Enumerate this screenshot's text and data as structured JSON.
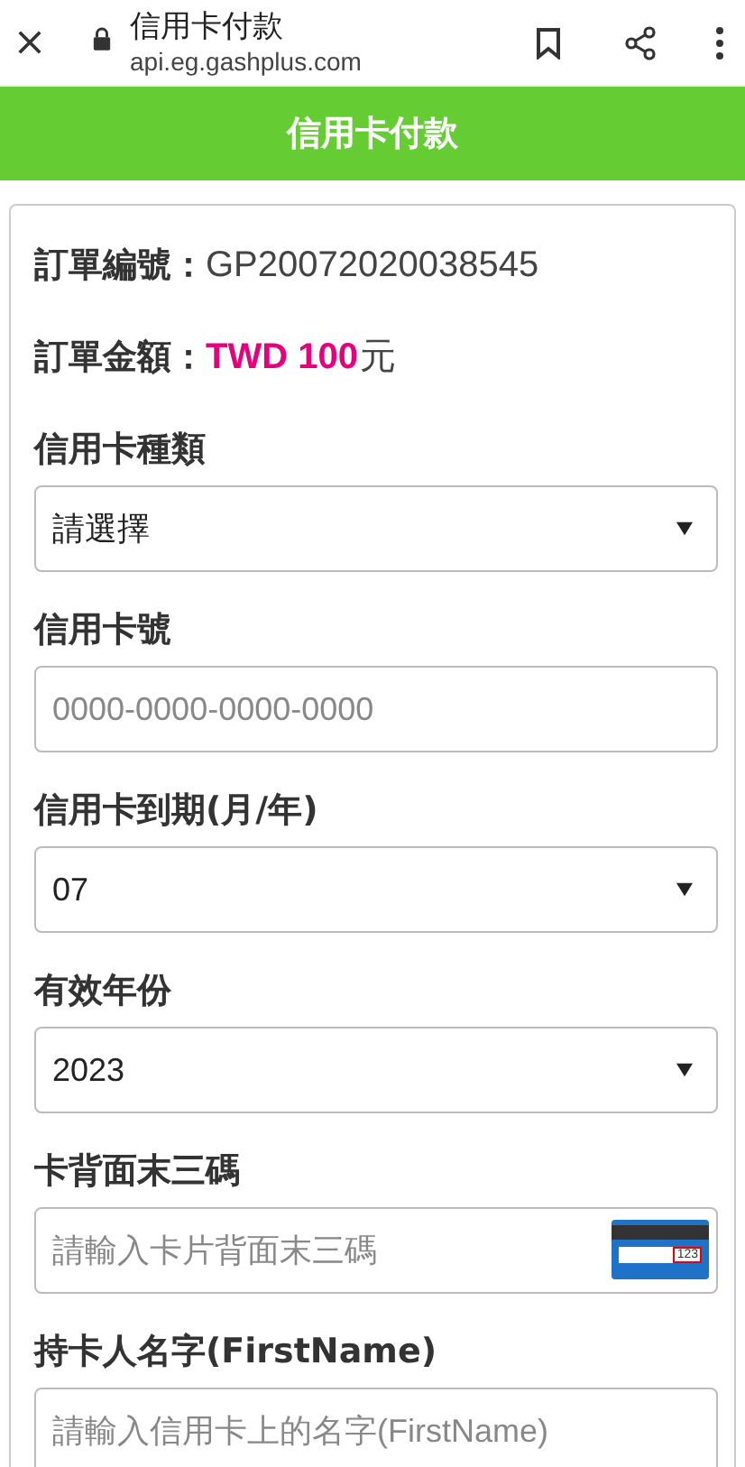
{
  "browser": {
    "title": "信用卡付款",
    "url": "api.eg.gashplus.com"
  },
  "header": {
    "title": "信用卡付款"
  },
  "order": [
    {
      "kind": "plain",
      "label": "訂單編號：",
      "value": "GP20072020038545"
    },
    {
      "kind": "amount",
      "label": "訂單金額：",
      "value": "TWD 100",
      "unit": "元"
    }
  ],
  "fields": [
    {
      "kind": "select",
      "label": "信用卡種類",
      "value": "請選擇"
    },
    {
      "kind": "input",
      "label": "信用卡號",
      "placeholder": "0000-0000-0000-0000"
    },
    {
      "kind": "select",
      "label": "信用卡到期(月/年)",
      "value": "07"
    },
    {
      "kind": "select",
      "label": "有效年份",
      "value": "2023"
    },
    {
      "kind": "cvv",
      "label": "卡背面末三碼",
      "placeholder": "請輸入卡片背面末三碼",
      "icon_text": "123"
    },
    {
      "kind": "input",
      "label": "持卡人名字(FirstName)",
      "placeholder": "請輸入信用卡上的名字(FirstName)"
    }
  ]
}
